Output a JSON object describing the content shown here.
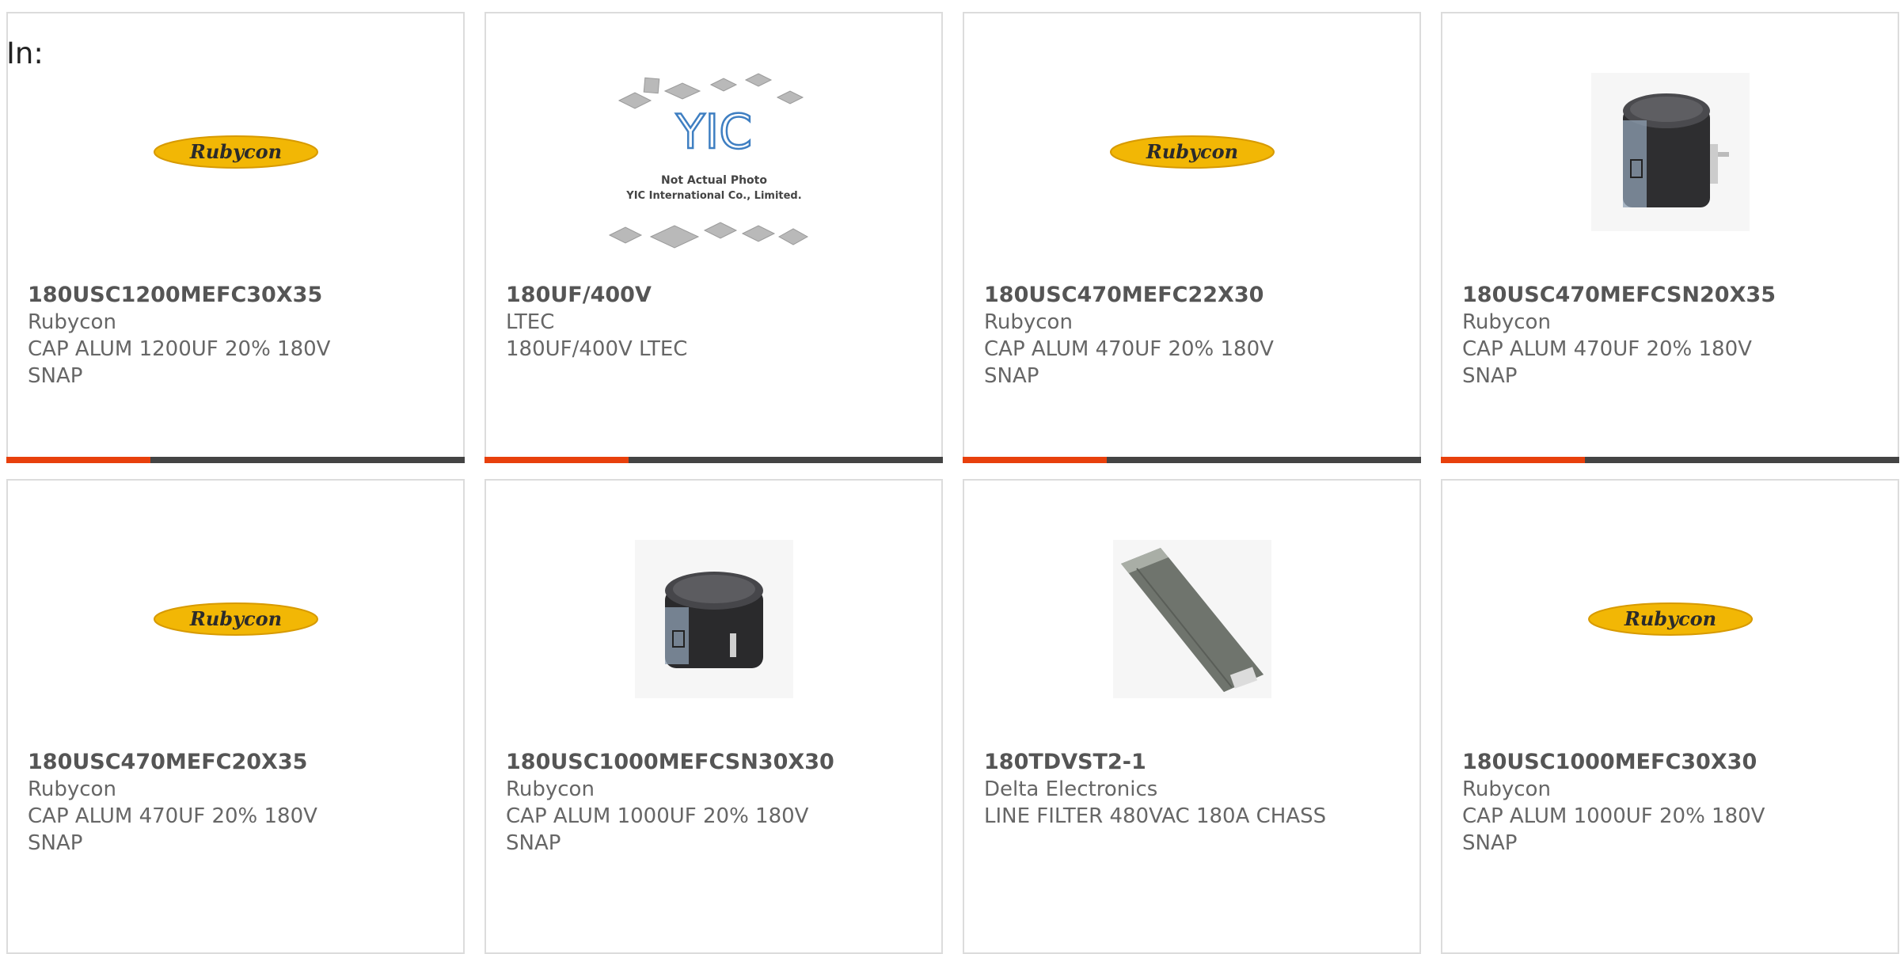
{
  "filter_label": "In:",
  "accent_color": "#e8400c",
  "products": [
    {
      "part_number": "180USC1200MEFC30X35",
      "manufacturer": "Rubycon",
      "description": "CAP ALUM 1200UF 20% 180V SNAP",
      "image": "rubycon-logo",
      "logo_text": "Rubycon"
    },
    {
      "part_number": "180UF/400V",
      "manufacturer": "LTEC",
      "description": "180UF/400V LTEC",
      "image": "not-actual-photo",
      "placeholder_lines": [
        "Not Actual Photo",
        "YIC International Co., Limited."
      ],
      "placeholder_logo": "YIC"
    },
    {
      "part_number": "180USC470MEFC22X30",
      "manufacturer": "Rubycon",
      "description": "CAP ALUM 470UF 20% 180V SNAP",
      "image": "rubycon-logo",
      "logo_text": "Rubycon"
    },
    {
      "part_number": "180USC470MEFCSN20X35",
      "manufacturer": "Rubycon",
      "description": "CAP ALUM 470UF 20% 180V SNAP",
      "image": "capacitor-photo"
    },
    {
      "part_number": "180USC470MEFC20X35",
      "manufacturer": "Rubycon",
      "description": "CAP ALUM 470UF 20% 180V SNAP",
      "image": "rubycon-logo",
      "logo_text": "Rubycon"
    },
    {
      "part_number": "180USC1000MEFCSN30X30",
      "manufacturer": "Rubycon",
      "description": "CAP ALUM 1000UF 20% 180V SNAP",
      "image": "capacitor-photo"
    },
    {
      "part_number": "180TDVST2-1",
      "manufacturer": "Delta Electronics",
      "description": "LINE FILTER 480VAC 180A CHASS",
      "image": "line-filter-photo"
    },
    {
      "part_number": "180USC1000MEFC30X30",
      "manufacturer": "Rubycon",
      "description": "CAP ALUM 1000UF 20% 180V SNAP",
      "image": "rubycon-logo",
      "logo_text": "Rubycon"
    }
  ]
}
